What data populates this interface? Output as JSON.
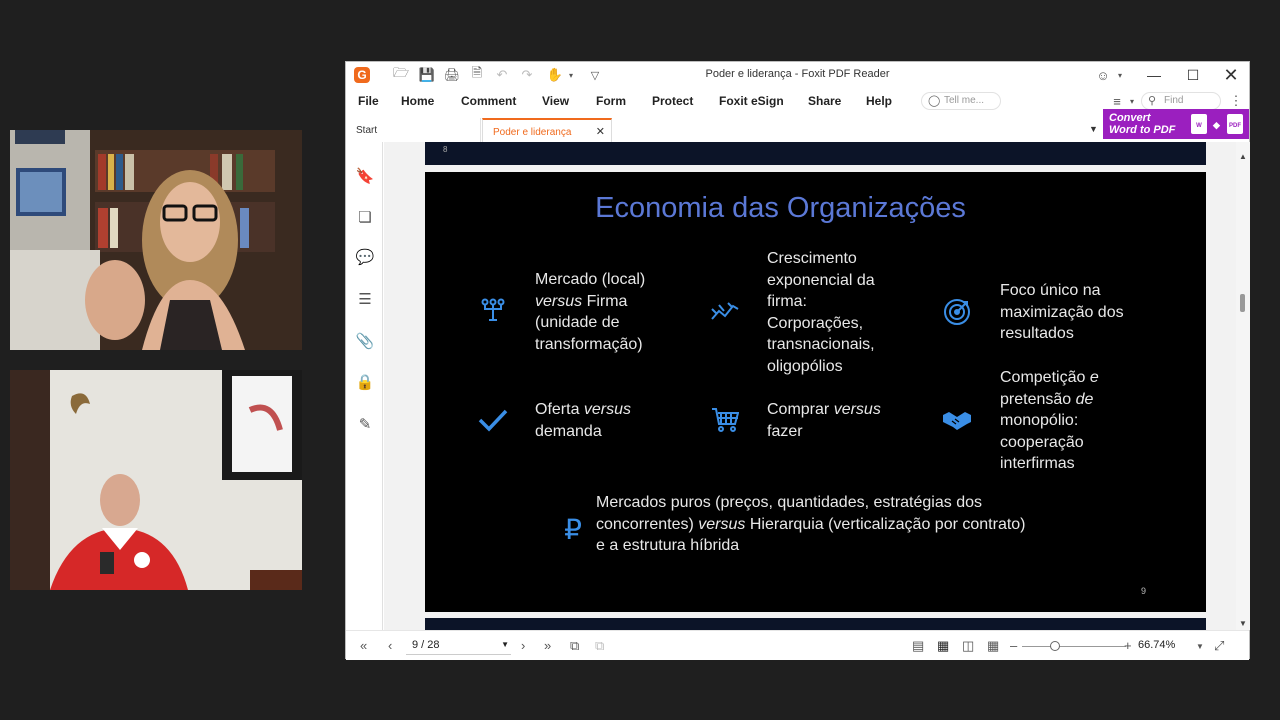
{
  "window": {
    "title": "Poder e liderança - Foxit PDF Reader",
    "app_logo": "G"
  },
  "menu": [
    "File",
    "Home",
    "Comment",
    "View",
    "Form",
    "Protect",
    "Foxit eSign",
    "Share",
    "Help"
  ],
  "tell_me_placeholder": "Tell me...",
  "find_placeholder": "Find",
  "tabs": {
    "start": "Start",
    "active": "Poder e liderança"
  },
  "convert": {
    "line1": "Convert",
    "line2": "Word to PDF",
    "doc_w": "W",
    "doc_pdf": "PDF"
  },
  "slide_prev_page": "8",
  "slide": {
    "title": "Economia das Organizações",
    "page": "9",
    "items": {
      "mercado_pre": "Mercado (local)",
      "mercado_em": "versus",
      "mercado_post": " Firma (unidade de transformação)",
      "crescimento": "Crescimento exponencial da firma: Corporações, transnacionais, oligopólios",
      "foco": "Foco único na maximização dos resultados",
      "oferta_pre": "Oferta ",
      "oferta_em": "versus",
      "oferta_post": " demanda",
      "comprar_pre": "Comprar ",
      "comprar_em": "versus",
      "comprar_post": " fazer",
      "competicao_pre": "Competição ",
      "competicao_em1": "e",
      "competicao_mid": " pretensão ",
      "competicao_em2": "de",
      "competicao_post": " monopólio: cooperação interfirmas",
      "mercados_pre": "Mercados puros (preços, quantidades, estratégias dos concorrentes) ",
      "mercados_em": "versus",
      "mercados_post": " Hierarquia (verticalização por contrato) e a estrutura híbrida"
    },
    "accent_color": "#3a8ee6",
    "title_color": "#5b78d6"
  },
  "status": {
    "page_indicator": "9 / 28",
    "zoom": "66.74%"
  }
}
